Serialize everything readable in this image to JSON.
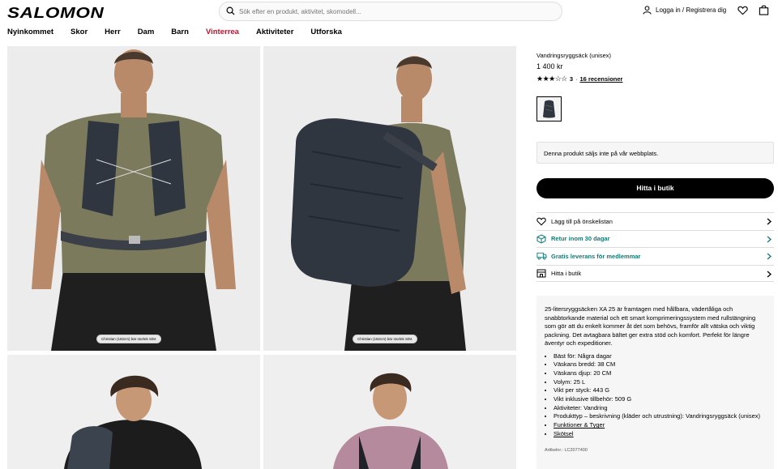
{
  "brand": "SALOMON",
  "search": {
    "placeholder": "Sök efter en produkt, aktivitet, skomodell..."
  },
  "account": {
    "login_label": "Logga in / Registrera dig"
  },
  "nav": [
    {
      "label": "Nyinkommet"
    },
    {
      "label": "Skor"
    },
    {
      "label": "Herr"
    },
    {
      "label": "Dam"
    },
    {
      "label": "Barn"
    },
    {
      "label": "Vinterrea"
    },
    {
      "label": "Aktiviteter"
    },
    {
      "label": "Utforska"
    }
  ],
  "gallery": {
    "captions": [
      "Christian (182cm) bär storlek S/M.",
      "Christian (182cm) bär storlek S/M."
    ]
  },
  "product": {
    "name": "Vandringsryggsäck (unisex)",
    "price": "1 400 kr",
    "rating_value": "3",
    "rating_stars": 3,
    "rating_sep": "·",
    "reviews_label": "16 recensioner",
    "notice": "Denna produkt säljs inte på vår webbplats.",
    "find_store_button": "Hitta i butik"
  },
  "links": [
    {
      "label": "Lägg till på önskelistan",
      "icon": "heart-icon",
      "teal": false
    },
    {
      "label": "Retur inom 30 dagar",
      "icon": "box-return-icon",
      "teal": true
    },
    {
      "label": "Gratis leverans för medlemmar",
      "icon": "truck-icon",
      "teal": true
    },
    {
      "label": "Hitta i butik",
      "icon": "store-icon",
      "teal": false
    }
  ],
  "description": {
    "text": "25-litersryggsäcken XA 25 är framtagen med hållbara, vädertåliga och snabbtorkande material och ett smart komprimeringssystem med rullstängning som gör att du enkelt kommer åt det som behövs, framför allt vätska och viktig packning. Det avtagbara bältet ger extra stöd och komfort. Perfekt för längre äventyr och expeditioner.",
    "specs": [
      "Bäst för: Några dagar",
      "Väskans bredd: 38 CM",
      "Väskans djup: 20 CM",
      "Volym: 25 L",
      "Vikt per styck: 443 G",
      "Vikt inklusive tillbehör: 509 G",
      "Aktiviteter: Vandring",
      "Produkttyp – beskrivning (kläder och utrustning): Vandringsryggsäck (unisex)"
    ],
    "link_features": "Funktioner & Tyger",
    "link_care": "Skötsel",
    "article": "Artikelnr.: LC2077400"
  },
  "colors": {
    "accent_red": "#c8102e",
    "teal": "#117a78",
    "shirt": "#7c7a5c",
    "pack": "#2f3640"
  }
}
